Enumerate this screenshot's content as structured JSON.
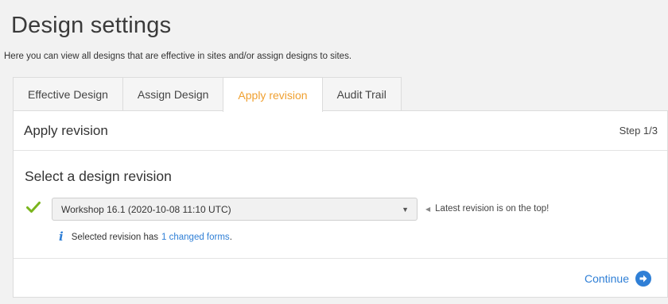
{
  "header": {
    "title": "Design settings",
    "subtitle": "Here you can view all designs that are effective in sites and/or assign designs to sites."
  },
  "tabs": [
    {
      "label": "Effective Design",
      "active": false
    },
    {
      "label": "Assign Design",
      "active": false
    },
    {
      "label": "Apply revision",
      "active": true
    },
    {
      "label": "Audit Trail",
      "active": false
    }
  ],
  "panel": {
    "title": "Apply revision",
    "step": "Step 1/3",
    "section_title": "Select a design revision",
    "select": {
      "value": "Workshop 16.1 (2020-10-08 11:10 UTC)"
    },
    "hint": "Latest revision is on the top!",
    "info": {
      "prefix": "Selected revision has",
      "link": "1 changed forms",
      "suffix": "."
    },
    "continue_label": "Continue"
  },
  "colors": {
    "accent_blue": "#2f7fd6",
    "active_tab": "#f0a030",
    "check_green": "#7ab51d"
  },
  "icons": {
    "check": "check-icon",
    "info": "info-icon",
    "continue": "arrow-right-circle-icon"
  }
}
